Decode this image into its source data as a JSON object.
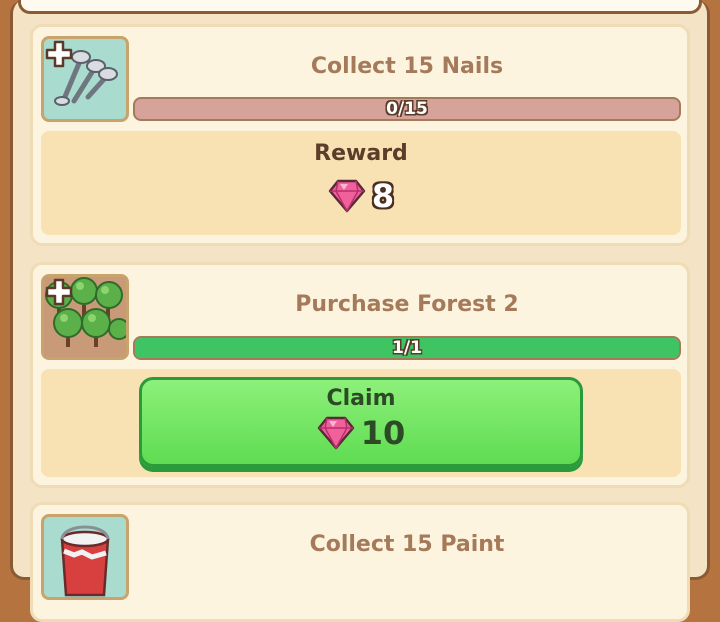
{
  "quests": [
    {
      "title": "Collect 15 Nails",
      "progress_text": "0/15",
      "progress": 0,
      "reward_label": "Reward",
      "reward_gems": "8",
      "state": "in_progress",
      "icon": "nails-icon"
    },
    {
      "title": "Purchase Forest 2",
      "progress_text": "1/1",
      "progress": 1,
      "claim_label": "Claim",
      "reward_gems": "10",
      "state": "claimable",
      "icon": "forest-icon"
    },
    {
      "title": "Collect 15 Paint",
      "state": "in_progress",
      "icon": "paint-bucket-icon"
    }
  ],
  "colors": {
    "progress_empty": "#d6a39a",
    "progress_full": "#3ec462",
    "claim_button": "#6fe25c",
    "gem": "#f0609a"
  }
}
